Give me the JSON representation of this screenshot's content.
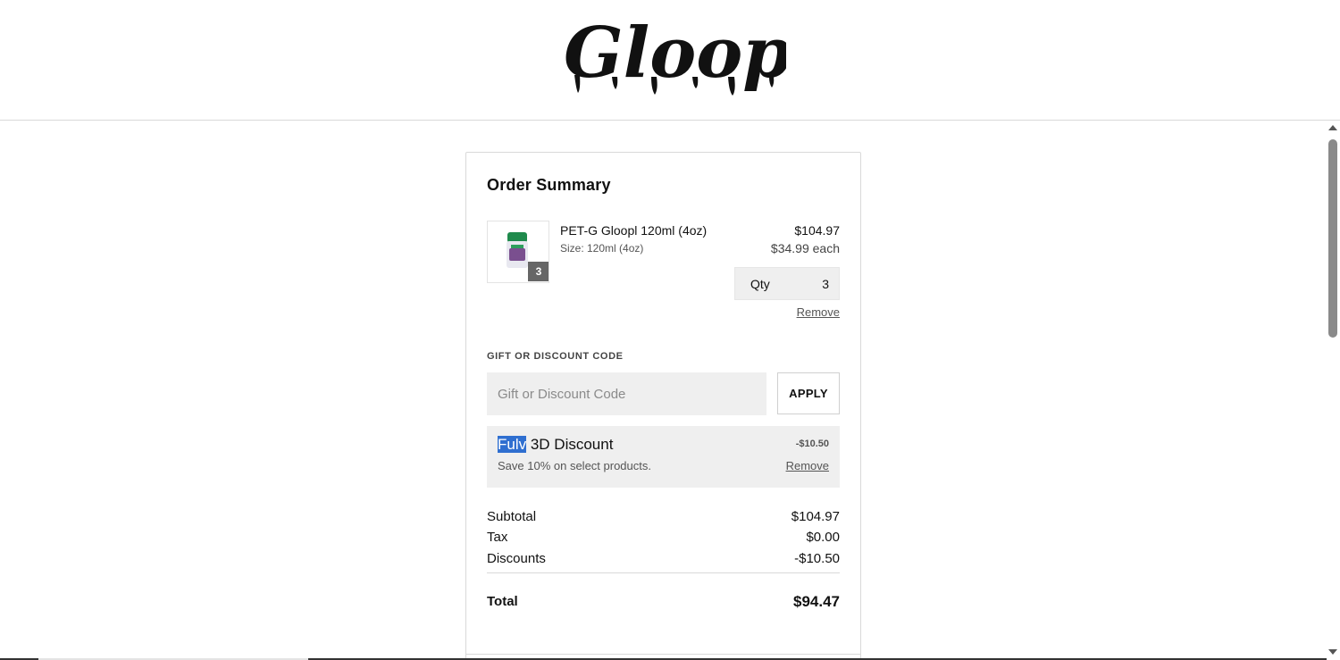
{
  "header": {
    "logo_text": "Gloop!"
  },
  "order_summary": {
    "title": "Order Summary",
    "item": {
      "name": "PET-G Gloopl 120ml (4oz)",
      "size": "Size: 120ml (4oz)",
      "quantity_badge": "3",
      "total_price": "$104.97",
      "unit_price": "$34.99 each",
      "qty_label": "Qty",
      "qty_value": "3",
      "remove_label": "Remove"
    },
    "discount_code": {
      "label": "GIFT OR DISCOUNT CODE",
      "placeholder": "Gift or Discount Code",
      "apply_label": "APPLY"
    },
    "applied_discount": {
      "name_highlighted": "Fulv",
      "name_rest": " 3D Discount",
      "description": "Save 10% on select products.",
      "amount": "-$10.50",
      "remove_label": "Remove"
    },
    "totals": {
      "subtotal_label": "Subtotal",
      "subtotal_value": "$104.97",
      "tax_label": "Tax",
      "tax_value": "$0.00",
      "discounts_label": "Discounts",
      "discounts_value": "-$10.50",
      "total_label": "Total",
      "total_value": "$94.47"
    }
  },
  "colors": {
    "text_highlight": "#2f6fd0",
    "panel_gray": "#efefef",
    "badge_gray": "#666666"
  }
}
